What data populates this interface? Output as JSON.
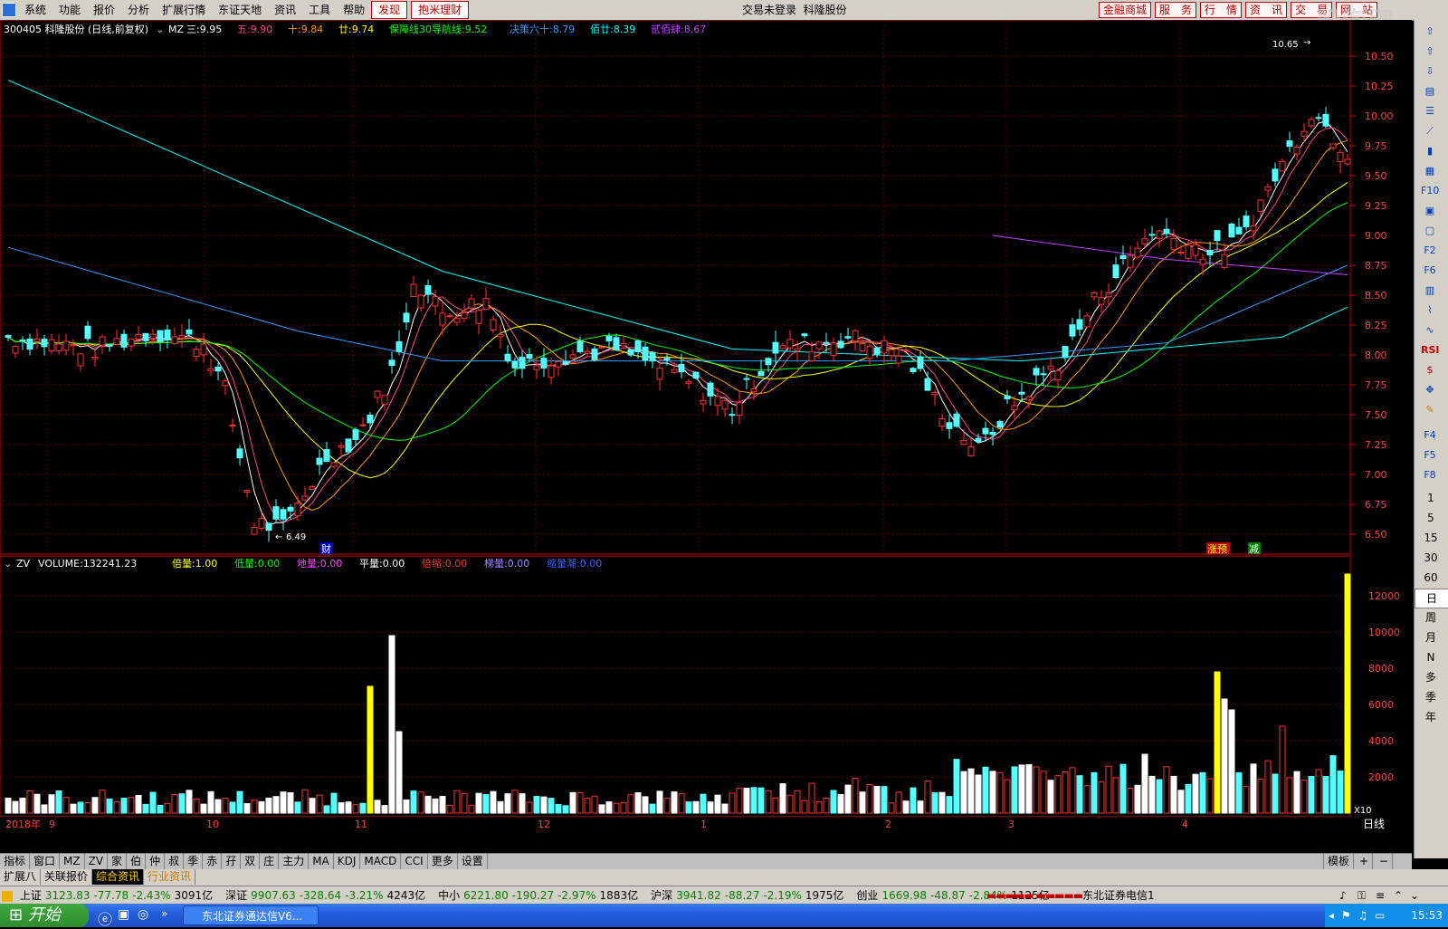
{
  "menu": {
    "items": [
      "系统",
      "功能",
      "报价",
      "分析",
      "扩展行情",
      "东证天地",
      "资讯",
      "工具",
      "帮助"
    ],
    "discover": "发现",
    "wealth": "抱米理财",
    "status_text": "交易未登录",
    "stock_title": "科隆股份",
    "right_buttons": [
      "金融商城",
      "服　务",
      "行　情",
      "资　讯",
      "交　易",
      "网　站"
    ],
    "watermark": "股海网"
  },
  "main_chart": {
    "header": {
      "code_name": "300405 科隆股份 (日线,前复权)",
      "indicator": "MZ",
      "items": [
        {
          "label": "三:",
          "value": "9.95",
          "color": "#ffffff"
        },
        {
          "label": "五:",
          "value": "9.90",
          "color": "#ff4090"
        },
        {
          "label": "十:",
          "value": "9.84",
          "color": "#ff9900"
        },
        {
          "label": "廿:",
          "value": "9.74",
          "color": "#ffff00"
        },
        {
          "label": "保障线30导航线:",
          "value": "9.52",
          "color": "#00ff00"
        },
        {
          "label": "决策六十:",
          "value": "8.79",
          "color": "#3399ff"
        },
        {
          "label": "佰廿:",
          "value": "8.39",
          "color": "#00ffff"
        },
        {
          "label": "贰佰肆:",
          "value": "8.67",
          "color": "#c040ff"
        }
      ]
    },
    "y_ticks": [
      "10.50",
      "10.25",
      "10.00",
      "9.75",
      "9.50",
      "9.25",
      "9.00",
      "8.75",
      "8.50",
      "8.25",
      "8.00",
      "7.75",
      "7.50",
      "7.25",
      "7.00",
      "6.75",
      "6.50"
    ],
    "high_label": "10.65",
    "low_label": "6.49",
    "markers": {
      "cai": "财",
      "zhangyu": "涨预",
      "jian": "减"
    }
  },
  "volume_chart": {
    "header": {
      "indicator": "ZV",
      "items": [
        {
          "label": "VOLUME:",
          "value": "132241.23",
          "color": "#ffffff"
        },
        {
          "label": "倍量:",
          "value": "1.00",
          "color": "#ffff00"
        },
        {
          "label": "低量:",
          "value": "0.00",
          "color": "#00ff00"
        },
        {
          "label": "地量:",
          "value": "0.00",
          "color": "#ff40ff"
        },
        {
          "label": "平量:",
          "value": "0.00",
          "color": "#ffffff"
        },
        {
          "label": "倍缩:",
          "value": "0.00",
          "color": "#ff3030"
        },
        {
          "label": "梯量:",
          "value": "0.00",
          "color": "#a080ff"
        },
        {
          "label": "缩量潮:",
          "value": "0.00",
          "color": "#3060ff"
        }
      ]
    },
    "y_ticks": [
      "12000",
      "10000",
      "8000",
      "6000",
      "4000",
      "2000"
    ],
    "unit": "X10"
  },
  "x_axis": {
    "labels": [
      "2018年",
      "9",
      "10",
      "11",
      "12",
      "1",
      "2",
      "3",
      "4"
    ],
    "period": "日线"
  },
  "toolbar_tabs": [
    "指标",
    "窗口",
    "MZ",
    "ZV",
    "家",
    "伯",
    "仲",
    "叔",
    "季",
    "赤",
    "孖",
    "双",
    "庄",
    "主力",
    "MA",
    "KDJ",
    "MACD",
    "CCI",
    "更多",
    "设置"
  ],
  "template_label": "模板",
  "bottom_tabs": [
    {
      "label": "扩展八",
      "active": false
    },
    {
      "label": "关联报价",
      "active": false
    },
    {
      "label": "综合资讯",
      "active": true
    },
    {
      "label": "行业资讯",
      "active": false
    }
  ],
  "periods": [
    "日",
    "周",
    "月",
    "N",
    "多",
    "季",
    "年"
  ],
  "minute_periods": [
    "1",
    "5",
    "15",
    "30",
    "60"
  ],
  "status": {
    "indices": [
      {
        "name": "上证",
        "value": "3123.83",
        "change": "-77.78",
        "pct": "-2.43%",
        "amount": "3091亿"
      },
      {
        "name": "深证",
        "value": "9907.63",
        "change": "-328.64",
        "pct": "-3.21%",
        "amount": "4243亿"
      },
      {
        "name": "中小",
        "value": "6221.80",
        "change": "-190.27",
        "pct": "-2.97%",
        "amount": "1883亿"
      },
      {
        "name": "沪深",
        "value": "3941.82",
        "change": "-88.27",
        "pct": "-2.19%",
        "amount": "1975亿"
      },
      {
        "name": "创业",
        "value": "1669.98",
        "change": "-48.87",
        "pct": "-2.84%",
        "amount": "1125亿"
      }
    ],
    "server": "东北证券电信1"
  },
  "taskbar": {
    "start": "开始",
    "window": "东北证券通达信V6...",
    "time": "15:53"
  },
  "colors": {
    "up": "#ff3030",
    "down": "#54ffff",
    "grid": "#8b0000",
    "axis": "#c00000"
  }
}
